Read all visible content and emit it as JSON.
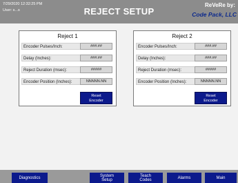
{
  "header": {
    "datetime": "7/29/2020 12:32:25 PM",
    "user": "User:  s...s",
    "title": "REJECT SETUP",
    "brand_line1": "ReVeRe by:",
    "brand_line2": "Code Pack, LLC"
  },
  "panels": [
    {
      "title": "Reject 1",
      "fields": [
        {
          "label": "Encoder Pulses/Inch:",
          "value": "###.##"
        },
        {
          "label": "Delay (Inches):",
          "value": "###.##"
        },
        {
          "label": "Reject Duration (msec):",
          "value": "#####"
        },
        {
          "label": "Encoder Position (Inches):",
          "value": "NNNNN.NN"
        }
      ],
      "reset_line1": "Reset",
      "reset_line2": "Encoder"
    },
    {
      "title": "Reject 2",
      "fields": [
        {
          "label": "Encoder Pulses/Inch:",
          "value": "###.##"
        },
        {
          "label": "Delay (Inches):",
          "value": "###.##"
        },
        {
          "label": "Reject Duration (msec):",
          "value": "#####"
        },
        {
          "label": "Encoder Position (Inches):",
          "value": "NNNNN.NN"
        }
      ],
      "reset_line1": "Reset",
      "reset_line2": "Encoder"
    }
  ],
  "nav": [
    {
      "line1": "Diagnostics",
      "line2": ""
    },
    {
      "line1": "System",
      "line2": "Setup"
    },
    {
      "line1": "Teach",
      "line2": "Codes"
    },
    {
      "line1": "Alarms",
      "line2": ""
    },
    {
      "line1": "Main",
      "line2": ""
    }
  ],
  "colors": {
    "header": "#8c8c8c",
    "button_blue": "#0c1a8c",
    "brand_blue": "#0d2a8c",
    "background": "#f2f2f2"
  }
}
